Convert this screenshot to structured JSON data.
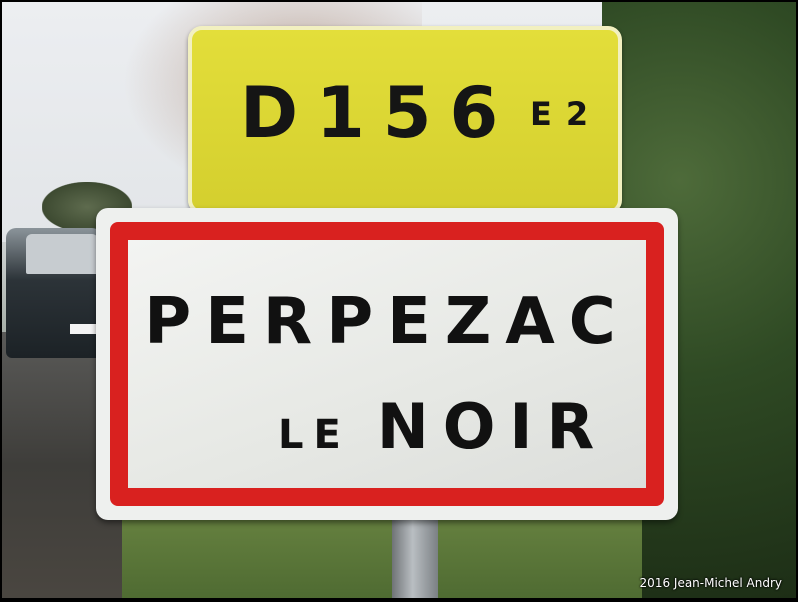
{
  "route_sign": {
    "road_number": "D156",
    "suffix": "E2",
    "color": "#d8d330"
  },
  "town_sign": {
    "line1": "PERPEZAC",
    "line2_prefix": "LE",
    "line2_main": "NOIR",
    "border_color": "#d9211f"
  },
  "credit": "2016 Jean-Michel Andry"
}
